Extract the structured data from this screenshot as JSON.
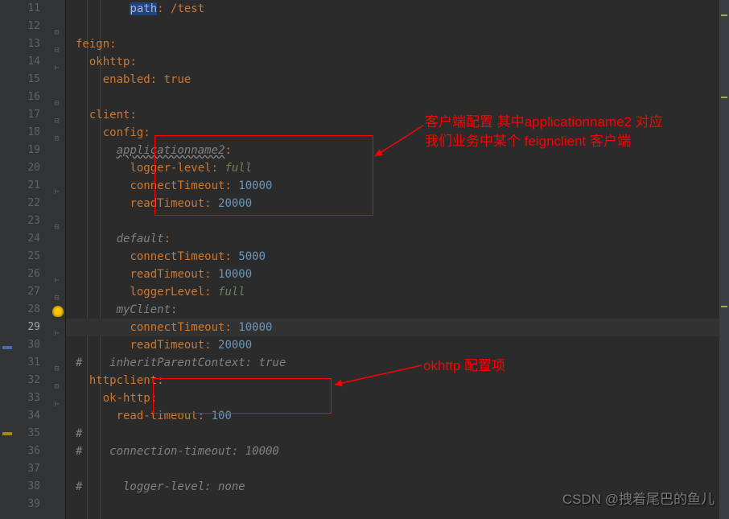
{
  "lineStart": 11,
  "lineEnd": 39,
  "currentLine": 29,
  "annotations": {
    "box1_text_line1": "客户端配置 其中applicationname2 对应",
    "box1_text_line2": "我们业务中某个 feignclient 客户端",
    "box2_text": "okhttp 配置项"
  },
  "watermark": "CSDN @拽着尾巴的鱼儿",
  "code": {
    "l11_key": "path",
    "l11_rest": ": /test",
    "l13_key": "feign",
    "l14_key": "okhttp",
    "l15_key": "enabled",
    "l15_val": "true",
    "l17_key": "client",
    "l18_key": "config",
    "l19_key": "applicationname2",
    "l20_key": "logger-level",
    "l20_val": "full",
    "l21_key": "connectTimeout",
    "l21_val": "10000",
    "l22_key": "readTimeout",
    "l22_val": "20000",
    "l24_key": "default",
    "l25_key": "connectTimeout",
    "l25_val": "5000",
    "l26_key": "readTimeout",
    "l26_val": "10000",
    "l27_key": "loggerLevel",
    "l27_val": "full",
    "l28_key": "myClient",
    "l29_key": "connectTimeout",
    "l29_val": "10000",
    "l30_key": "readTimeout",
    "l30_val": "20000",
    "l31_comment": "#    inheritParentContext: true",
    "l32_key": "httpclient",
    "l33_key": "ok-http",
    "l34_key": "read-timeout",
    "l34_val": "100",
    "l35_comment": "#",
    "l36_comment": "#    connection-timeout: 10000",
    "l38_comment": "#      logger-level: none"
  }
}
